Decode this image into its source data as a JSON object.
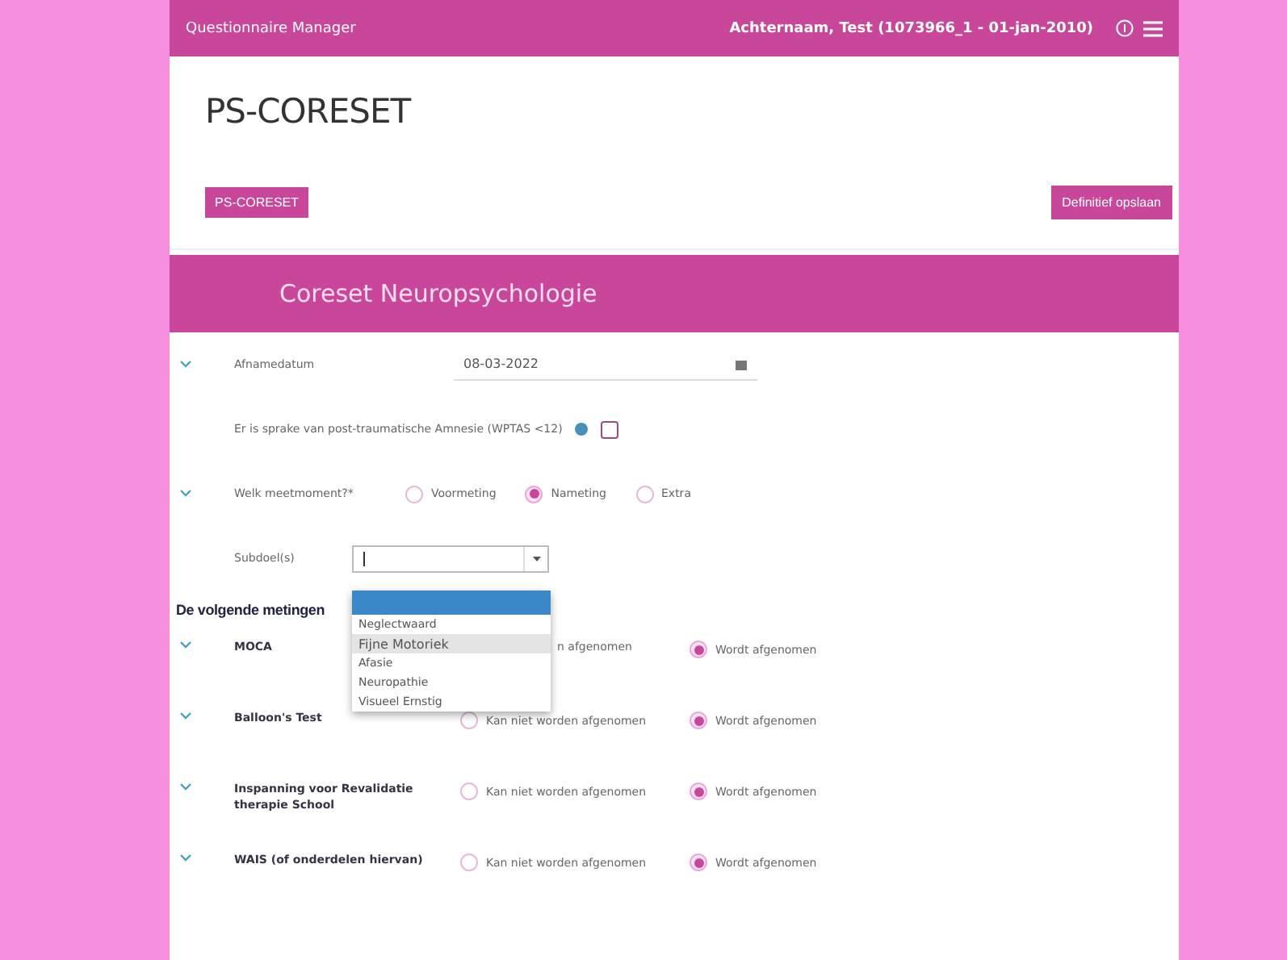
{
  "topbar": {
    "app_title": "Questionnaire Manager",
    "patient": "Achternaam, Test (1073966_1 - 01-jan-2010)"
  },
  "page_title": "PS-CORESET",
  "breadcrumb": "PS-CORESET",
  "save_button": "Definitief opslaan",
  "section_title": "Coreset Neuropsychologie",
  "date_field": {
    "label": "Afnamedatum",
    "value": "08-03-2022"
  },
  "pta": {
    "label": "Er is sprake van post-traumatische Amnesie (WPTAS <12)",
    "checked": false
  },
  "moment": {
    "label": "Welk meetmoment?*",
    "options": [
      {
        "label": "Voormeting",
        "selected": false
      },
      {
        "label": "Nameting",
        "selected": true
      },
      {
        "label": "Extra",
        "selected": false
      }
    ]
  },
  "subdoel": {
    "label": "Subdoel(s)",
    "options": [
      {
        "selected": true,
        "hovered": false
      },
      {
        "label": "Neglectwaard",
        "selected": false,
        "hovered": false
      },
      {
        "label": "Fijne Motoriek",
        "selected": false,
        "hovered": true
      },
      {
        "label": "Afasie",
        "selected": false,
        "hovered": false
      },
      {
        "label": "Neuropathie",
        "selected": false,
        "hovered": false
      },
      {
        "label": "Visueel Ernstig",
        "selected": false,
        "hovered": false
      }
    ]
  },
  "measurements_heading": "De volgende metingen",
  "measurements": [
    {
      "name": "MOCA",
      "options": [
        {
          "label": "n afgenomen"
        },
        {
          "label": "Wordt afgenomen",
          "selected": true
        }
      ]
    },
    {
      "name": "Balloon's Test",
      "options": [
        {
          "label": "Kan niet worden afgenomen",
          "selected": false
        },
        {
          "label": "Wordt afgenomen",
          "selected": true
        }
      ]
    },
    {
      "name": "Inspanning voor Revalidatie therapie School",
      "options": [
        {
          "label": "Kan niet worden afgenomen",
          "selected": false
        },
        {
          "label": "Wordt afgenomen",
          "selected": true
        }
      ]
    },
    {
      "name": "WAIS (of onderdelen hiervan)",
      "options": [
        {
          "label": "Kan niet worden afgenomen",
          "selected": false
        },
        {
          "label": "Wordt afgenomen",
          "selected": true
        }
      ]
    }
  ]
}
